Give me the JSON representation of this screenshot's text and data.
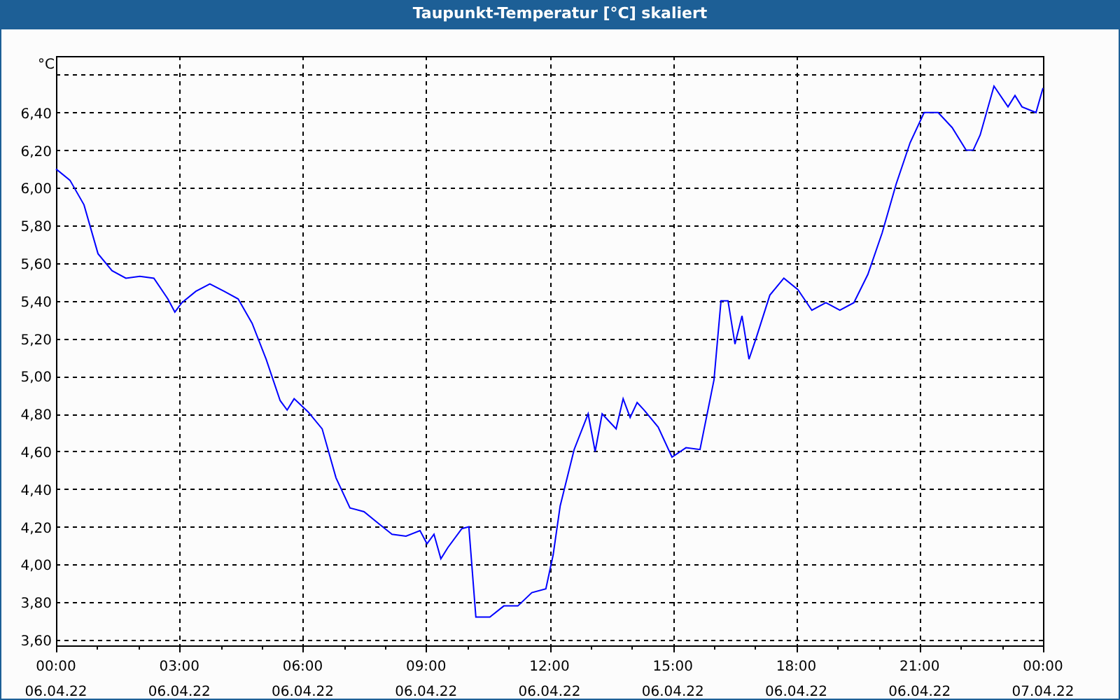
{
  "window": {
    "title": "Taupunkt-Temperatur [°C] skaliert"
  },
  "chart": {
    "chart_data": {
      "type": "line",
      "grid": true,
      "ylabel": "°C",
      "xlim": [
        0,
        24
      ],
      "ylim": [
        3.57,
        6.7
      ],
      "xticks": [
        {
          "value": 0,
          "label": "00:00"
        },
        {
          "value": 3,
          "label": "03:00"
        },
        {
          "value": 6,
          "label": "06:00"
        },
        {
          "value": 9,
          "label": "09:00"
        },
        {
          "value": 12,
          "label": "12:00"
        },
        {
          "value": 15,
          "label": "15:00"
        },
        {
          "value": 18,
          "label": "18:00"
        },
        {
          "value": 21,
          "label": "21:00"
        },
        {
          "value": 24,
          "label": "00:00"
        }
      ],
      "annotations": [
        "06.04.22",
        "06.04.22",
        "06.04.22",
        "06.04.22",
        "06.04.22",
        "06.04.22",
        "06.04.22",
        "06.04.22",
        "07.04.22"
      ],
      "yticks": [
        {
          "value": 3.6,
          "label": "3,60"
        },
        {
          "value": 3.8,
          "label": "3,80"
        },
        {
          "value": 4.0,
          "label": "4,00"
        },
        {
          "value": 4.2,
          "label": "4,20"
        },
        {
          "value": 4.4,
          "label": "4,40"
        },
        {
          "value": 4.6,
          "label": "4,60"
        },
        {
          "value": 4.8,
          "label": "4,80"
        },
        {
          "value": 5.0,
          "label": "5,00"
        },
        {
          "value": 5.2,
          "label": "5,20"
        },
        {
          "value": 5.4,
          "label": "5,40"
        },
        {
          "value": 5.6,
          "label": "5,60"
        },
        {
          "value": 5.8,
          "label": "5,80"
        },
        {
          "value": 6.0,
          "label": "6,00"
        },
        {
          "value": 6.2,
          "label": "6,20"
        },
        {
          "value": 6.4,
          "label": "6,40"
        }
      ],
      "x": [
        0,
        0.34,
        0.68,
        1.02,
        1.36,
        1.7,
        2.04,
        2.38,
        2.72,
        2.89,
        3.06,
        3.4,
        3.74,
        4.09,
        4.43,
        4.77,
        5.11,
        5.45,
        5.62,
        5.79,
        6.13,
        6.47,
        6.81,
        7.15,
        7.49,
        7.83,
        8.17,
        8.51,
        8.85,
        9.02,
        9.19,
        9.36,
        9.53,
        9.87,
        10.04,
        10.21,
        10.55,
        10.89,
        11.23,
        11.57,
        11.91,
        12.09,
        12.26,
        12.6,
        12.94,
        13.11,
        13.28,
        13.62,
        13.79,
        13.96,
        14.13,
        14.3,
        14.64,
        14.98,
        15.32,
        15.66,
        16.0,
        16.17,
        16.34,
        16.51,
        16.68,
        16.85,
        17.02,
        17.36,
        17.7,
        18.04,
        18.38,
        18.72,
        19.06,
        19.4,
        19.74,
        20.09,
        20.43,
        20.77,
        21.11,
        21.45,
        21.79,
        22.13,
        22.3,
        22.47,
        22.81,
        23.15,
        23.32,
        23.49,
        23.83,
        24.0
      ],
      "series": [
        {
          "color": "#0000ff",
          "values": [
            6.1,
            6.04,
            5.91,
            5.65,
            5.56,
            5.52,
            5.53,
            5.52,
            5.41,
            5.34,
            5.39,
            5.45,
            5.49,
            5.45,
            5.41,
            5.28,
            5.09,
            4.87,
            4.82,
            4.88,
            4.81,
            4.72,
            4.46,
            4.3,
            4.28,
            4.22,
            4.16,
            4.15,
            4.18,
            4.11,
            4.16,
            4.03,
            4.09,
            4.19,
            4.2,
            3.72,
            3.72,
            3.78,
            3.78,
            3.85,
            3.87,
            4.05,
            4.31,
            4.61,
            4.8,
            4.6,
            4.8,
            4.72,
            4.88,
            4.78,
            4.86,
            4.82,
            4.73,
            4.57,
            4.62,
            4.61,
            4.98,
            5.4,
            5.4,
            5.17,
            5.32,
            5.09,
            5.2,
            5.43,
            5.52,
            5.46,
            5.35,
            5.39,
            5.35,
            5.39,
            5.54,
            5.76,
            6.02,
            6.24,
            6.4,
            6.4,
            6.32,
            6.2,
            6.2,
            6.28,
            6.54,
            6.43,
            6.49,
            6.43,
            6.4,
            6.53
          ]
        }
      ]
    }
  }
}
